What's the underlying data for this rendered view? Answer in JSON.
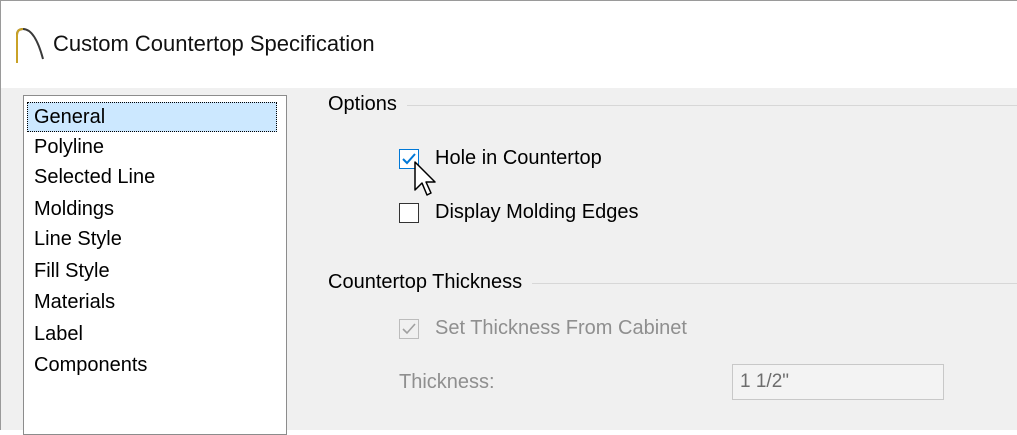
{
  "window": {
    "title": "Custom Countertop Specification",
    "icon": "countertop-arc-icon"
  },
  "sidebar": {
    "items": [
      {
        "label": "General",
        "selected": true
      },
      {
        "label": "Polyline"
      },
      {
        "label": "Selected Line"
      },
      {
        "label": "Moldings"
      },
      {
        "label": "Line Style"
      },
      {
        "label": "Fill Style"
      },
      {
        "label": "Materials"
      },
      {
        "label": "Label"
      },
      {
        "label": "Components"
      }
    ]
  },
  "options": {
    "heading": "Options",
    "hole_in_countertop": {
      "label": "Hole in Countertop",
      "checked": true
    },
    "display_molding_edges": {
      "label": "Display Molding Edges",
      "checked": false
    }
  },
  "thickness": {
    "heading": "Countertop Thickness",
    "set_from_cabinet": {
      "label": "Set Thickness From Cabinet",
      "checked": true,
      "disabled": true
    },
    "thickness_label": "Thickness:",
    "thickness_value": "1 1/2\""
  },
  "colors": {
    "selection": "#cce8ff",
    "accent": "#0078d7",
    "dialog_bg": "#f0f0f0"
  }
}
